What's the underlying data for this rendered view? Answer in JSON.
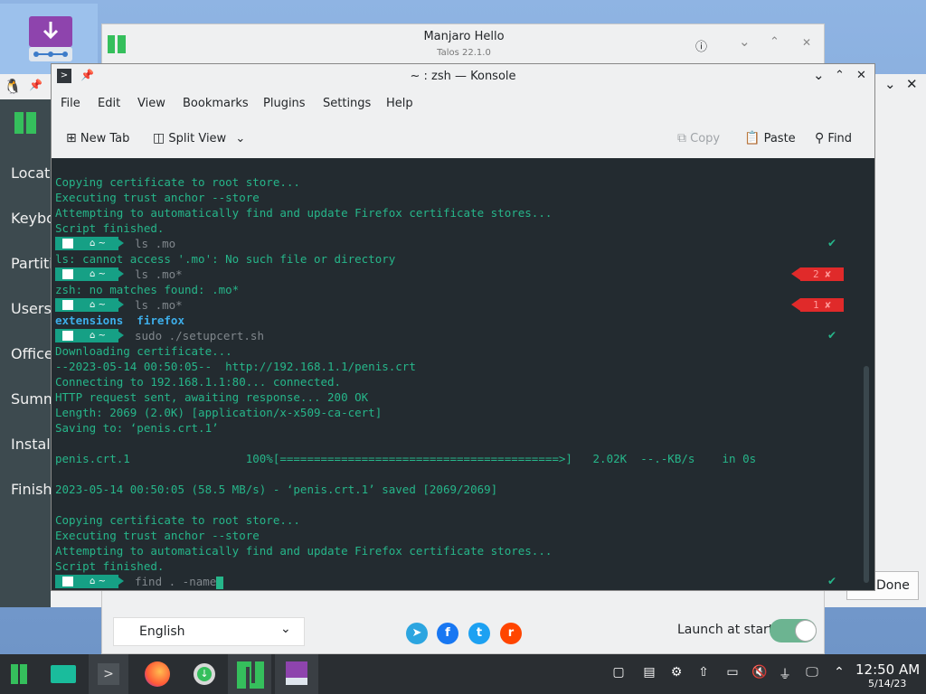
{
  "installer": {
    "sidebar_items": [
      "Locati",
      "Keybo",
      "Partiti",
      "Users",
      "Office",
      "Summ",
      "Instal",
      "Finish"
    ],
    "done_label": "Done"
  },
  "hello": {
    "title": "Manjaro Hello",
    "subtitle": "Talos 22.1.0",
    "language": "English",
    "launch_label": "Launch at start",
    "launch_on": true
  },
  "konsole": {
    "title": "~ : zsh — Konsole",
    "menu": [
      "File",
      "Edit",
      "View",
      "Bookmarks",
      "Plugins",
      "Settings",
      "Help"
    ],
    "toolbar": {
      "new_tab": "New Tab",
      "split_view": "Split View",
      "copy": "Copy",
      "paste": "Paste",
      "find": "Find"
    },
    "lines": [
      {
        "text": "Copying certificate to root store..."
      },
      {
        "text": "Executing trust anchor --store"
      },
      {
        "text": "Attempting to automatically find and update Firefox certificate stores..."
      },
      {
        "text": "Script finished."
      },
      {
        "prompt": true,
        "cmd": "ls .mo",
        "status": "ok"
      },
      {
        "text": "ls: cannot access '.mo': No such file or directory"
      },
      {
        "prompt": true,
        "cmd": "ls .mo*",
        "status": "err",
        "code": "2 ✘"
      },
      {
        "text": "zsh: no matches found: .mo*"
      },
      {
        "prompt": true,
        "cmd": "ls .mo*",
        "status": "err",
        "code": "1 ✘"
      },
      {
        "dirs": "extensions  firefox"
      },
      {
        "prompt": true,
        "cmd": "sudo ./setupcert.sh",
        "status": "ok"
      },
      {
        "text": "Downloading certificate..."
      },
      {
        "text": "--2023-05-14 00:50:05--  http://192.168.1.1/penis.crt"
      },
      {
        "text": "Connecting to 192.168.1.1:80... connected."
      },
      {
        "text": "HTTP request sent, awaiting response... 200 OK"
      },
      {
        "text": "Length: 2069 (2.0K) [application/x-x509-ca-cert]"
      },
      {
        "text": "Saving to: ‘penis.crt.1’"
      },
      {
        "text": ""
      },
      {
        "text": "penis.crt.1                 100%[=========================================>]   2.02K  --.-KB/s    in 0s"
      },
      {
        "text": ""
      },
      {
        "text": "2023-05-14 00:50:05 (58.5 MB/s) - ‘penis.crt.1’ saved [2069/2069]"
      },
      {
        "text": ""
      },
      {
        "text": "Copying certificate to root store..."
      },
      {
        "text": "Executing trust anchor --store"
      },
      {
        "text": "Attempting to automatically find and update Firefox certificate stores..."
      },
      {
        "text": "Script finished."
      },
      {
        "prompt": true,
        "cmd": "find . -name",
        "status": "ok",
        "cursor": true
      }
    ],
    "status_ok": "✔",
    "colors": {
      "terminal_bg": "#232b30",
      "text": "#26b68a",
      "prompt": "#16a085",
      "error": "#e02a2a"
    }
  },
  "taskbar": {
    "apps": [
      "manjaro-menu-icon",
      "file-manager-icon",
      "konsole-icon",
      "firefox-icon",
      "update-icon",
      "manjaro-hello-icon",
      "installer-icon"
    ],
    "clock_time": "12:50 AM",
    "clock_date": "5/14/23"
  }
}
